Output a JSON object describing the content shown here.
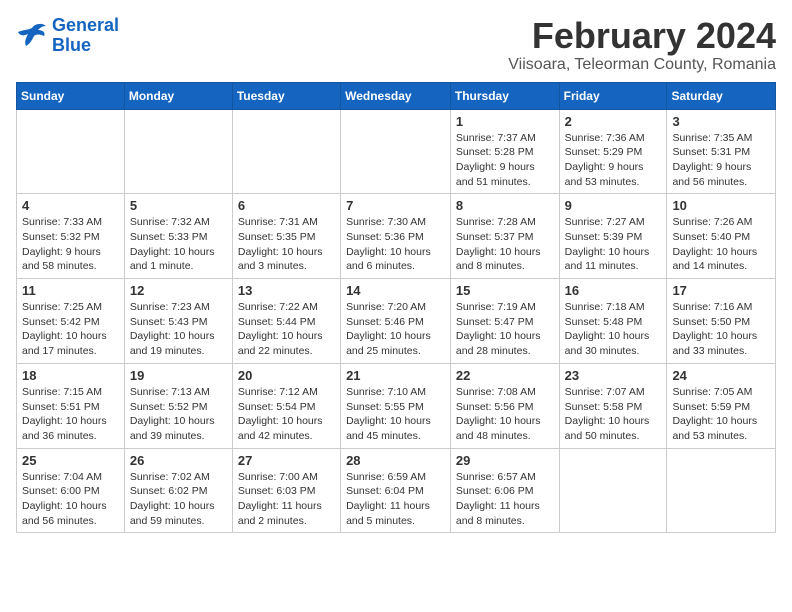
{
  "logo": {
    "line1": "General",
    "line2": "Blue"
  },
  "title": "February 2024",
  "subtitle": "Viisoara, Teleorman County, Romania",
  "weekdays": [
    "Sunday",
    "Monday",
    "Tuesday",
    "Wednesday",
    "Thursday",
    "Friday",
    "Saturday"
  ],
  "weeks": [
    [
      {
        "day": "",
        "info": ""
      },
      {
        "day": "",
        "info": ""
      },
      {
        "day": "",
        "info": ""
      },
      {
        "day": "",
        "info": ""
      },
      {
        "day": "1",
        "info": "Sunrise: 7:37 AM\nSunset: 5:28 PM\nDaylight: 9 hours\nand 51 minutes."
      },
      {
        "day": "2",
        "info": "Sunrise: 7:36 AM\nSunset: 5:29 PM\nDaylight: 9 hours\nand 53 minutes."
      },
      {
        "day": "3",
        "info": "Sunrise: 7:35 AM\nSunset: 5:31 PM\nDaylight: 9 hours\nand 56 minutes."
      }
    ],
    [
      {
        "day": "4",
        "info": "Sunrise: 7:33 AM\nSunset: 5:32 PM\nDaylight: 9 hours\nand 58 minutes."
      },
      {
        "day": "5",
        "info": "Sunrise: 7:32 AM\nSunset: 5:33 PM\nDaylight: 10 hours\nand 1 minute."
      },
      {
        "day": "6",
        "info": "Sunrise: 7:31 AM\nSunset: 5:35 PM\nDaylight: 10 hours\nand 3 minutes."
      },
      {
        "day": "7",
        "info": "Sunrise: 7:30 AM\nSunset: 5:36 PM\nDaylight: 10 hours\nand 6 minutes."
      },
      {
        "day": "8",
        "info": "Sunrise: 7:28 AM\nSunset: 5:37 PM\nDaylight: 10 hours\nand 8 minutes."
      },
      {
        "day": "9",
        "info": "Sunrise: 7:27 AM\nSunset: 5:39 PM\nDaylight: 10 hours\nand 11 minutes."
      },
      {
        "day": "10",
        "info": "Sunrise: 7:26 AM\nSunset: 5:40 PM\nDaylight: 10 hours\nand 14 minutes."
      }
    ],
    [
      {
        "day": "11",
        "info": "Sunrise: 7:25 AM\nSunset: 5:42 PM\nDaylight: 10 hours\nand 17 minutes."
      },
      {
        "day": "12",
        "info": "Sunrise: 7:23 AM\nSunset: 5:43 PM\nDaylight: 10 hours\nand 19 minutes."
      },
      {
        "day": "13",
        "info": "Sunrise: 7:22 AM\nSunset: 5:44 PM\nDaylight: 10 hours\nand 22 minutes."
      },
      {
        "day": "14",
        "info": "Sunrise: 7:20 AM\nSunset: 5:46 PM\nDaylight: 10 hours\nand 25 minutes."
      },
      {
        "day": "15",
        "info": "Sunrise: 7:19 AM\nSunset: 5:47 PM\nDaylight: 10 hours\nand 28 minutes."
      },
      {
        "day": "16",
        "info": "Sunrise: 7:18 AM\nSunset: 5:48 PM\nDaylight: 10 hours\nand 30 minutes."
      },
      {
        "day": "17",
        "info": "Sunrise: 7:16 AM\nSunset: 5:50 PM\nDaylight: 10 hours\nand 33 minutes."
      }
    ],
    [
      {
        "day": "18",
        "info": "Sunrise: 7:15 AM\nSunset: 5:51 PM\nDaylight: 10 hours\nand 36 minutes."
      },
      {
        "day": "19",
        "info": "Sunrise: 7:13 AM\nSunset: 5:52 PM\nDaylight: 10 hours\nand 39 minutes."
      },
      {
        "day": "20",
        "info": "Sunrise: 7:12 AM\nSunset: 5:54 PM\nDaylight: 10 hours\nand 42 minutes."
      },
      {
        "day": "21",
        "info": "Sunrise: 7:10 AM\nSunset: 5:55 PM\nDaylight: 10 hours\nand 45 minutes."
      },
      {
        "day": "22",
        "info": "Sunrise: 7:08 AM\nSunset: 5:56 PM\nDaylight: 10 hours\nand 48 minutes."
      },
      {
        "day": "23",
        "info": "Sunrise: 7:07 AM\nSunset: 5:58 PM\nDaylight: 10 hours\nand 50 minutes."
      },
      {
        "day": "24",
        "info": "Sunrise: 7:05 AM\nSunset: 5:59 PM\nDaylight: 10 hours\nand 53 minutes."
      }
    ],
    [
      {
        "day": "25",
        "info": "Sunrise: 7:04 AM\nSunset: 6:00 PM\nDaylight: 10 hours\nand 56 minutes."
      },
      {
        "day": "26",
        "info": "Sunrise: 7:02 AM\nSunset: 6:02 PM\nDaylight: 10 hours\nand 59 minutes."
      },
      {
        "day": "27",
        "info": "Sunrise: 7:00 AM\nSunset: 6:03 PM\nDaylight: 11 hours\nand 2 minutes."
      },
      {
        "day": "28",
        "info": "Sunrise: 6:59 AM\nSunset: 6:04 PM\nDaylight: 11 hours\nand 5 minutes."
      },
      {
        "day": "29",
        "info": "Sunrise: 6:57 AM\nSunset: 6:06 PM\nDaylight: 11 hours\nand 8 minutes."
      },
      {
        "day": "",
        "info": ""
      },
      {
        "day": "",
        "info": ""
      }
    ]
  ]
}
